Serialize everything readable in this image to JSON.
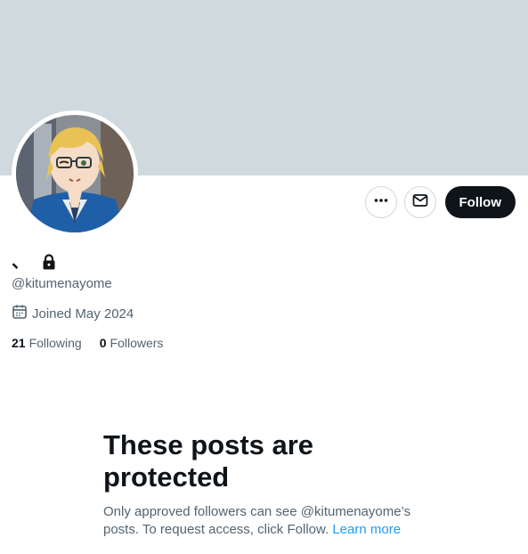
{
  "profile": {
    "display_name": "、",
    "handle": "@kitumenayome",
    "joined": "Joined May 2024",
    "following_count": "21",
    "following_label": "Following",
    "followers_count": "0",
    "followers_label": "Followers"
  },
  "actions": {
    "more_icon": "more-horizontal-icon",
    "message_icon": "mail-icon",
    "follow_label": "Follow"
  },
  "protected": {
    "title": "These posts are protected",
    "description": "Only approved followers can see @kitumenayome’s posts. To request access, click Follow.",
    "learn_more": "Learn more"
  },
  "colors": {
    "banner": "#cfd9de",
    "text_primary": "#0f1419",
    "text_secondary": "#536471",
    "link": "#1d9bf0",
    "follow_button_bg": "#0f1419"
  }
}
